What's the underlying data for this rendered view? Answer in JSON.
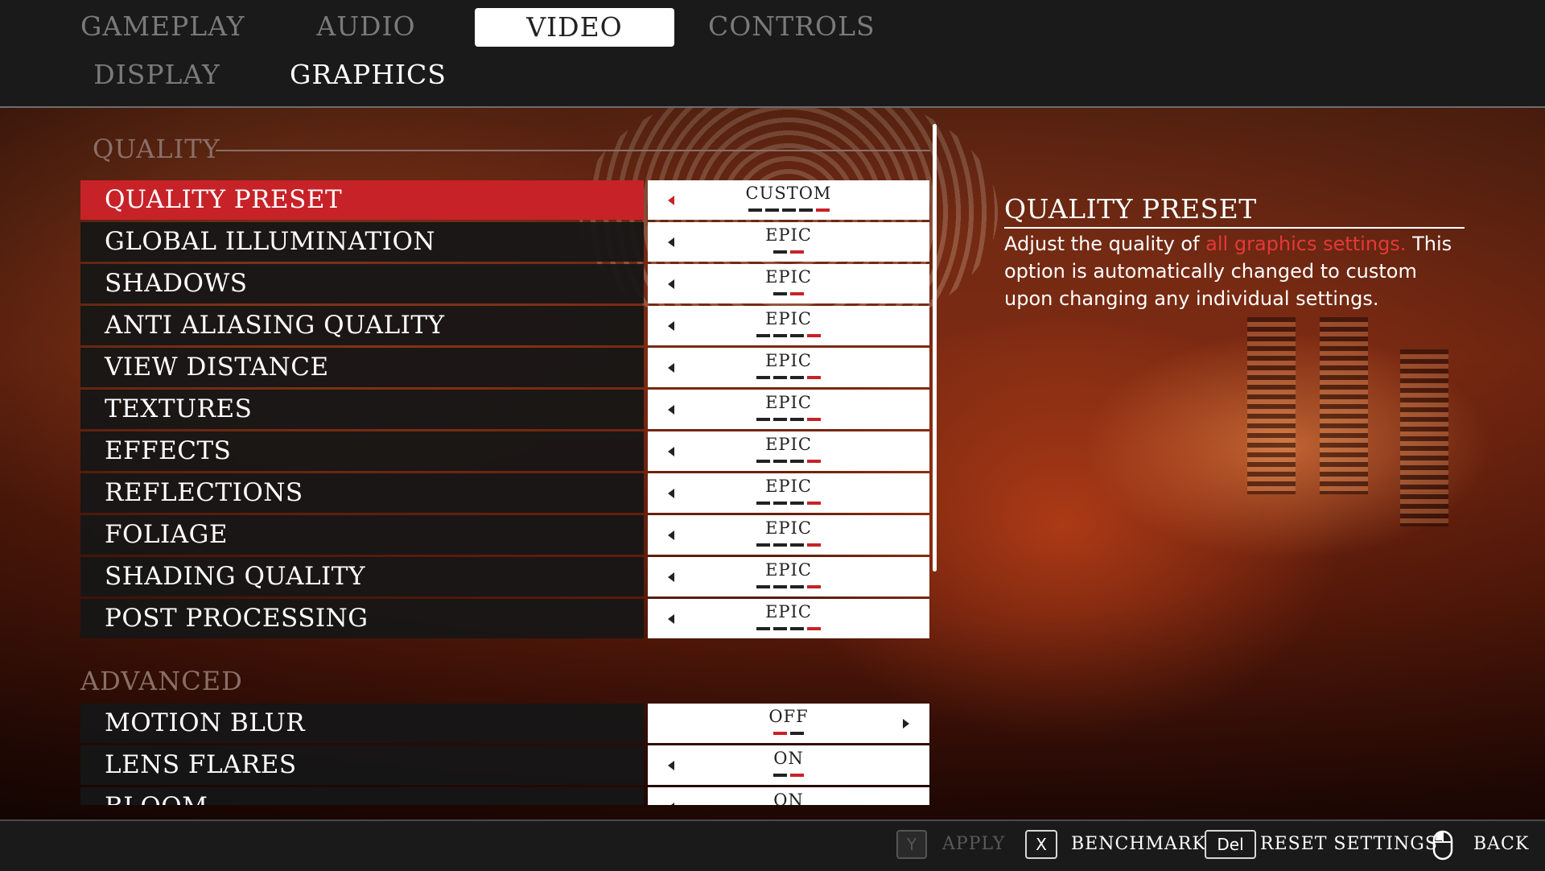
{
  "tabs": [
    {
      "label": "GAMEPLAY",
      "active": false
    },
    {
      "label": "AUDIO",
      "active": false
    },
    {
      "label": "VIDEO",
      "active": true
    },
    {
      "label": "CONTROLS",
      "active": false
    }
  ],
  "subtabs": [
    {
      "label": "DISPLAY",
      "active": false
    },
    {
      "label": "GRAPHICS",
      "active": true
    }
  ],
  "quality": {
    "heading": "QUALITY",
    "rows": [
      {
        "label": "QUALITY PRESET",
        "value": "CUSTOM",
        "levels": 5,
        "level": 5,
        "selected": true
      },
      {
        "label": "GLOBAL ILLUMINATION",
        "value": "EPIC",
        "levels": 2,
        "level": 2
      },
      {
        "label": "SHADOWS",
        "value": "EPIC",
        "levels": 2,
        "level": 2
      },
      {
        "label": "ANTI ALIASING QUALITY",
        "value": "EPIC",
        "levels": 4,
        "level": 4
      },
      {
        "label": "VIEW DISTANCE",
        "value": "EPIC",
        "levels": 4,
        "level": 4
      },
      {
        "label": "TEXTURES",
        "value": "EPIC",
        "levels": 4,
        "level": 4
      },
      {
        "label": "EFFECTS",
        "value": "EPIC",
        "levels": 4,
        "level": 4
      },
      {
        "label": "REFLECTIONS",
        "value": "EPIC",
        "levels": 4,
        "level": 4
      },
      {
        "label": "FOLIAGE",
        "value": "EPIC",
        "levels": 4,
        "level": 4
      },
      {
        "label": "SHADING QUALITY",
        "value": "EPIC",
        "levels": 4,
        "level": 4
      },
      {
        "label": "POST PROCESSING",
        "value": "EPIC",
        "levels": 4,
        "level": 4
      }
    ]
  },
  "advanced": {
    "heading": "ADVANCED",
    "rows": [
      {
        "label": "MOTION BLUR",
        "value": "OFF",
        "levels": 2,
        "level": 1
      },
      {
        "label": "LENS FLARES",
        "value": "ON",
        "levels": 2,
        "level": 2
      },
      {
        "label": "BLOOM",
        "value": "ON",
        "levels": 2,
        "level": 2
      }
    ]
  },
  "description": {
    "title": "QUALITY PRESET",
    "text_before": "Adjust the quality of ",
    "highlight": "all graphics settings.",
    "text_after": " This option is automatically changed to custom upon changing any individual settings."
  },
  "footer": {
    "apply_key": "Y",
    "apply_label": "APPLY",
    "benchmark_key": "X",
    "benchmark_label": "BENCHMARK",
    "reset_key": "Del",
    "reset_label": "RESET SETTINGS",
    "back_label": "BACK"
  },
  "colors": {
    "accent": "#c72228",
    "highlight": "#e5383b"
  }
}
